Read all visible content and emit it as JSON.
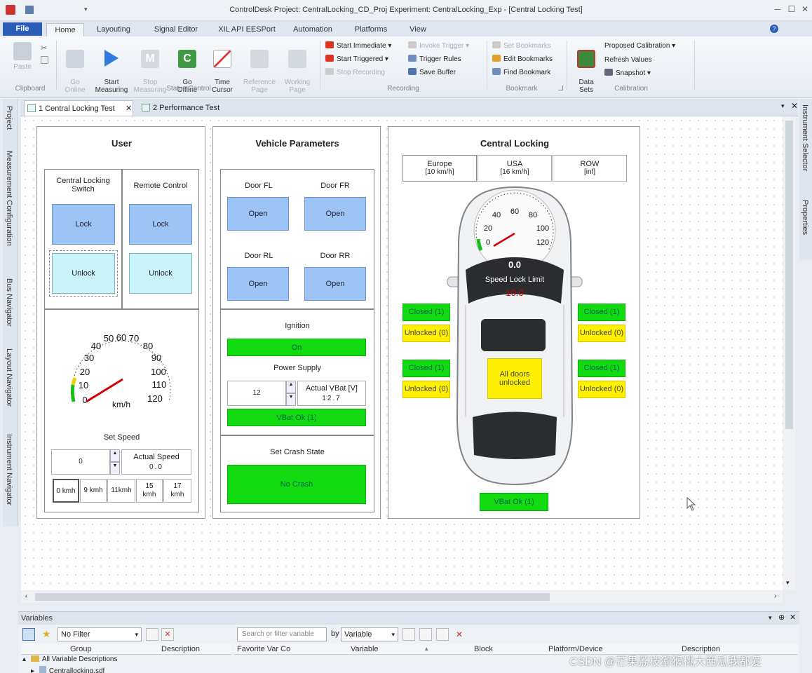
{
  "window": {
    "title": "ControlDesk  Project: CentralLocking_CD_Proj  Experiment: CentralLocking_Exp - [Central Locking Test]"
  },
  "ribbon_tabs": [
    "File",
    "Home",
    "Layouting",
    "Signal Editor",
    "XIL API EESPort",
    "Automation",
    "Platforms",
    "View"
  ],
  "ribbon": {
    "paste": "Paste",
    "go_online": "Go\nOnline",
    "start_measuring": "Start\nMeasuring",
    "stop_measuring": "Stop\nMeasuring",
    "go_offline": "Go\nOffline",
    "time_cursor": "Time\nCursor",
    "reference_page": "Reference\nPage",
    "working_page": "Working\nPage",
    "start_immediate": "Start Immediate",
    "start_triggered": "Start Triggered",
    "stop_recording": "Stop Recording",
    "invoke_trigger": "Invoke Trigger",
    "trigger_rules": "Trigger Rules",
    "save_buffer": "Save Buffer",
    "set_bookmarks": "Set Bookmarks",
    "edit_bookmarks": "Edit Bookmarks",
    "find_bookmark": "Find Bookmark",
    "data_sets": "Data\nSets",
    "proposed_calibration": "Proposed Calibration",
    "refresh_values": "Refresh Values",
    "snapshot": "Snapshot",
    "groups": {
      "clipboard": "Clipboard",
      "status_control": "Status Control",
      "recording": "Recording",
      "bookmark": "Bookmark",
      "calibration": "Calibration"
    }
  },
  "doc_tabs": [
    "1 Central Locking Test",
    "2 Performance Test"
  ],
  "left_nav": [
    "Project",
    "Measurement Configuration",
    "Bus Navigator",
    "Layout Navigator",
    "Instrument Navigator"
  ],
  "right_nav": [
    "Instrument Selector",
    "Properties"
  ],
  "user_panel": {
    "title": "User",
    "cls_label": "Central Locking\nSwitch",
    "remote_label": "Remote Control",
    "lock": "Lock",
    "unlock": "Unlock",
    "gauge_labels": [
      "0",
      "10",
      "20",
      "30",
      "40",
      "50",
      "60",
      "70",
      "80",
      "90",
      "100",
      "110",
      "120"
    ],
    "gauge_unit": "km/h",
    "set_speed": "Set Speed",
    "speed_value": "0",
    "actual_speed_label": "Actual Speed",
    "actual_speed_value": "0.0",
    "speed_buttons": [
      "0 kmh",
      "9 kmh",
      "11kmh",
      "15\nkmh",
      "17\nkmh"
    ]
  },
  "vehicle_panel": {
    "title": "Vehicle Parameters",
    "door_fl": "Door FL",
    "door_fr": "Door FR",
    "door_rl": "Door RL",
    "door_rr": "Door RR",
    "open": "Open",
    "ignition": "Ignition",
    "ignition_state": "On",
    "power_supply": "Power Supply",
    "vbat_set": "12",
    "actual_vbat_label": "Actual VBat [V]",
    "actual_vbat_value": "12.7",
    "vbat_ok": "VBat Ok (1)",
    "crash_title": "Set Crash State",
    "crash_state": "No Crash"
  },
  "central_panel": {
    "title": "Central Locking",
    "region_tabs": [
      {
        "name": "Europe",
        "sub": "[10 km/h]"
      },
      {
        "name": "USA",
        "sub": "[16 km/h]"
      },
      {
        "name": "ROW",
        "sub": "[inf]"
      }
    ],
    "gauge_labels": [
      "0",
      "20",
      "40",
      "60",
      "80",
      "100",
      "120"
    ],
    "speed_readout": "0.0",
    "speed_lock_label": "Speed Lock Limit",
    "speed_lock_value": "10.0",
    "closed": "Closed (1)",
    "unlocked": "Unlocked (0)",
    "all_doors": "All doors\nunlocked",
    "vbat_ok": "VBat Ok (1)"
  },
  "variables": {
    "title": "Variables",
    "filter": "No Filter",
    "col_group": "Group",
    "col_desc": "Description",
    "search_placeholder": "Search or filter variable",
    "by_label": "by",
    "by_value": "Variable",
    "col_favorite": "Favorite Var Co",
    "col_variable": "Variable",
    "col_block": "Block",
    "col_platform": "Platform/Device",
    "col_description": "Description",
    "tree_root": "All Variable Descriptions",
    "tree_child": "Centrallocking.sdf"
  },
  "watermark": "CSDN @芒果荔枝猕猴桃大西瓜我都爱",
  "colors": {
    "green": "#12db12",
    "yellow": "#ffef00",
    "blue_button": "#9cc4f4",
    "file_tab": "#2a5cb8"
  }
}
